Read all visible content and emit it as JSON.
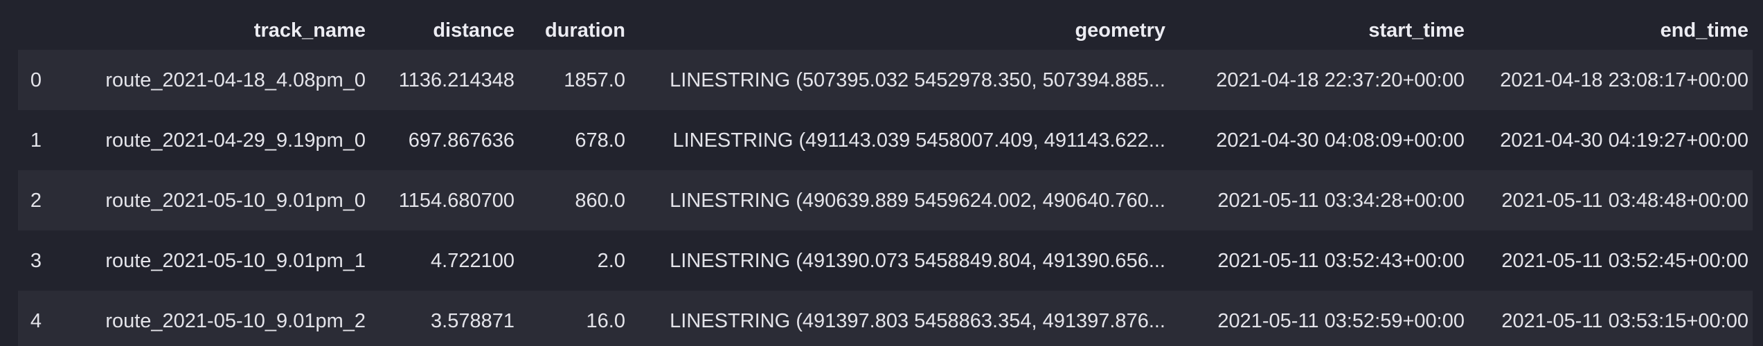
{
  "dataframe": {
    "columns": [
      "",
      "track_name",
      "distance",
      "duration",
      "geometry",
      "start_time",
      "end_time"
    ],
    "rows": [
      {
        "index": "0",
        "track_name": "route_2021-04-18_4.08pm_0",
        "distance": "1136.214348",
        "duration": "1857.0",
        "geometry": "LINESTRING (507395.032 5452978.350, 507394.885...",
        "start_time": "2021-04-18 22:37:20+00:00",
        "end_time": "2021-04-18 23:08:17+00:00"
      },
      {
        "index": "1",
        "track_name": "route_2021-04-29_9.19pm_0",
        "distance": "697.867636",
        "duration": "678.0",
        "geometry": "LINESTRING (491143.039 5458007.409, 491143.622...",
        "start_time": "2021-04-30 04:08:09+00:00",
        "end_time": "2021-04-30 04:19:27+00:00"
      },
      {
        "index": "2",
        "track_name": "route_2021-05-10_9.01pm_0",
        "distance": "1154.680700",
        "duration": "860.0",
        "geometry": "LINESTRING (490639.889 5459624.002, 490640.760...",
        "start_time": "2021-05-11 03:34:28+00:00",
        "end_time": "2021-05-11 03:48:48+00:00"
      },
      {
        "index": "3",
        "track_name": "route_2021-05-10_9.01pm_1",
        "distance": "4.722100",
        "duration": "2.0",
        "geometry": "LINESTRING (491390.073 5458849.804, 491390.656...",
        "start_time": "2021-05-11 03:52:43+00:00",
        "end_time": "2021-05-11 03:52:45+00:00"
      },
      {
        "index": "4",
        "track_name": "route_2021-05-10_9.01pm_2",
        "distance": "3.578871",
        "duration": "16.0",
        "geometry": "LINESTRING (491397.803 5458863.354, 491397.876...",
        "start_time": "2021-05-11 03:52:59+00:00",
        "end_time": "2021-05-11 03:53:15+00:00"
      }
    ]
  },
  "colors": {
    "background": "#22232d",
    "row_stripe": "#2b2c36",
    "text": "#e4e4ea"
  }
}
